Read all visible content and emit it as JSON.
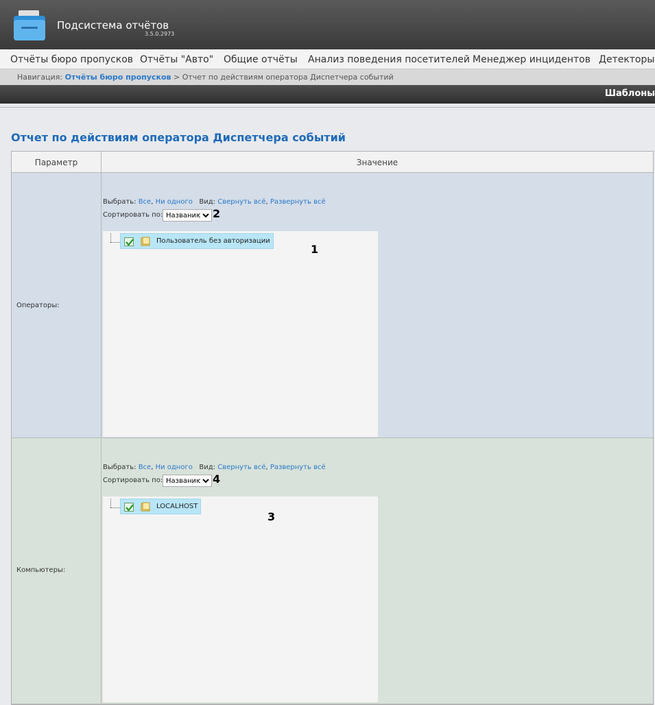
{
  "app": {
    "title": "Подсистема отчётов",
    "version": "3.5.0.2973"
  },
  "menu": [
    "Отчёты бюро пропусков",
    "Отчёты \"Авто\"",
    "Общие отчёты",
    "Анализ поведения посетителей",
    "Менеджер инцидентов",
    "Детекторы г"
  ],
  "breadcrumb": {
    "prefix": "Навигация:",
    "link": "Отчёты бюро пропусков",
    "separator": ">",
    "current": "Отчет по действиям оператора Диспетчера событий"
  },
  "templates_label": "Шаблоны",
  "page_title": "Отчет по действиям оператора Диспетчера событий",
  "table": {
    "col_param": "Параметр",
    "col_value": "Значение"
  },
  "operators": {
    "label": "Операторы:",
    "select_label": "Выбрать:",
    "all": "Все",
    "none": "Ни одного",
    "view_label": "Вид:",
    "collapse": "Свернуть всё",
    "expand": "Развернуть всё",
    "sort_label": "Сортировать по:",
    "sort_value": "Названию",
    "sort_marker": "2",
    "tree_marker": "1",
    "node": "Пользователь без авторизации"
  },
  "computers": {
    "label": "Компьютеры:",
    "select_label": "Выбрать:",
    "all": "Все",
    "none": "Ни одного",
    "view_label": "Вид:",
    "collapse": "Свернуть всё",
    "expand": "Развернуть всё",
    "sort_label": "Сортировать по:",
    "sort_value": "Названию",
    "sort_marker": "4",
    "tree_marker": "3",
    "node": "LOCALHOST"
  },
  "icons": {
    "logo": "folder-logo-icon",
    "check": "checkbox-checked-icon",
    "folder": "folder-icon"
  }
}
